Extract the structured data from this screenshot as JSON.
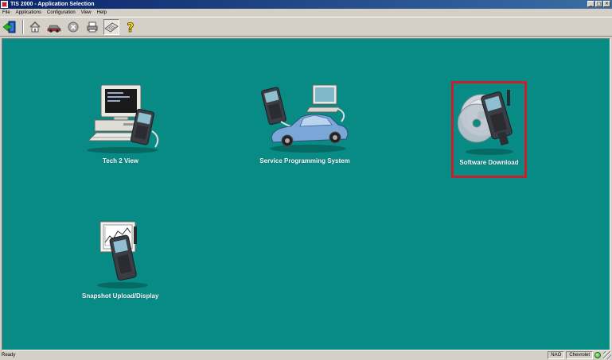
{
  "window": {
    "title": "TIS 2000 - Application Selection",
    "buttons": {
      "minimize": "_",
      "maximize": "□",
      "close": "×"
    }
  },
  "menu": [
    "File",
    "Applications",
    "Configuration",
    "View",
    "Help"
  ],
  "toolbar": {
    "items": [
      {
        "icon": "exit-icon"
      },
      {
        "icon": "home-icon"
      },
      {
        "icon": "vehicle-icon"
      },
      {
        "icon": "stop-icon"
      },
      {
        "icon": "print-icon"
      },
      {
        "icon": "keyboard-icon",
        "pressed": true
      },
      {
        "icon": "help-icon",
        "glyph": "?"
      }
    ]
  },
  "apps": [
    {
      "id": "tech2-view",
      "label": "Tech 2 View"
    },
    {
      "id": "service-programming",
      "label": "Service Programming System"
    },
    {
      "id": "software-download",
      "label": "Software Download",
      "selected": true
    },
    {
      "id": "snapshot",
      "label": "Snapshot Upload/Display"
    }
  ],
  "status": {
    "text": "Ready",
    "region": "NAO",
    "make": "Chevrolet"
  },
  "colors": {
    "background": "#088b84",
    "selection": "#c8202a",
    "titlebar_start": "#0a246a",
    "titlebar_end": "#3a6ea5"
  }
}
